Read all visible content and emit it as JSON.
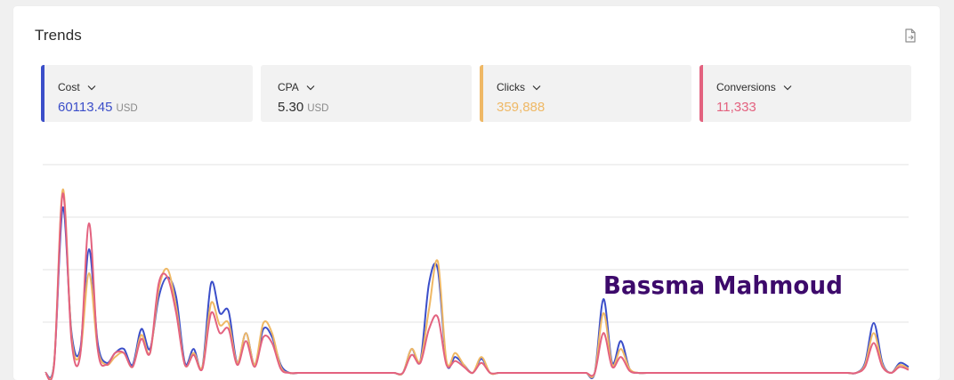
{
  "panel": {
    "title": "Trends",
    "export_icon": "file-export-icon"
  },
  "metrics": [
    {
      "label": "Cost",
      "value": "60113.45",
      "unit": "USD",
      "color": "#3b4ec9",
      "value_color": "#3b4ec9"
    },
    {
      "label": "CPA",
      "value": "5.30",
      "unit": "USD",
      "color": null,
      "value_color": "#2d2d2d"
    },
    {
      "label": "Clicks",
      "value": "359,888",
      "unit": "",
      "color": "#efb865",
      "value_color": "#efb865"
    },
    {
      "label": "Conversions",
      "value": "11,333",
      "unit": "",
      "color": "#e3627f",
      "value_color": "#e3627f"
    }
  ],
  "watermark": "Bassma Mahmoud",
  "chart_data": {
    "type": "line",
    "grid": true,
    "legend": "none",
    "ylim": [
      0,
      1
    ],
    "x": [
      0,
      1,
      2,
      3,
      4,
      5,
      6,
      7,
      8,
      9,
      10,
      11,
      12,
      13,
      14,
      15,
      16,
      17,
      18,
      19,
      20,
      21,
      22,
      23,
      24,
      25,
      26,
      27,
      28,
      29,
      30,
      31,
      32,
      33,
      34,
      35,
      36,
      37,
      38,
      39,
      40,
      41,
      42,
      43,
      44,
      45,
      46,
      47,
      48,
      49,
      50,
      51,
      52,
      53,
      54,
      55,
      56,
      57,
      58,
      59,
      60,
      61,
      62,
      63,
      64,
      65,
      66,
      67,
      68,
      69,
      70,
      71,
      72,
      73,
      74,
      75,
      76,
      77,
      78,
      79,
      80,
      81,
      82,
      83,
      84,
      85,
      86,
      87,
      88,
      89,
      90,
      91,
      92,
      93,
      94,
      95,
      96,
      97,
      98,
      99
    ],
    "series": [
      {
        "color": "#3b4ec9",
        "values": [
          0.0,
          0.05,
          0.83,
          0.2,
          0.12,
          0.62,
          0.15,
          0.05,
          0.1,
          0.12,
          0.04,
          0.22,
          0.12,
          0.38,
          0.48,
          0.38,
          0.05,
          0.12,
          0.03,
          0.45,
          0.3,
          0.31,
          0.05,
          0.2,
          0.04,
          0.22,
          0.18,
          0.04,
          0.0,
          0.0,
          0.0,
          0.0,
          0.0,
          0.0,
          0.0,
          0.0,
          0.0,
          0.0,
          0.0,
          0.0,
          0.0,
          0.0,
          0.12,
          0.06,
          0.45,
          0.52,
          0.05,
          0.08,
          0.04,
          0.0,
          0.07,
          0.0,
          0.0,
          0.0,
          0.0,
          0.0,
          0.0,
          0.0,
          0.0,
          0.0,
          0.0,
          0.0,
          0.0,
          0.0,
          0.37,
          0.05,
          0.16,
          0.02,
          0.0,
          0.0,
          0.0,
          0.0,
          0.0,
          0.0,
          0.0,
          0.0,
          0.0,
          0.0,
          0.0,
          0.0,
          0.0,
          0.0,
          0.0,
          0.0,
          0.0,
          0.0,
          0.0,
          0.0,
          0.0,
          0.0,
          0.0,
          0.0,
          0.0,
          0.0,
          0.05,
          0.25,
          0.05,
          0.0,
          0.05,
          0.03
        ]
      },
      {
        "color": "#efb865",
        "values": [
          0.0,
          0.05,
          0.92,
          0.18,
          0.1,
          0.5,
          0.12,
          0.04,
          0.08,
          0.1,
          0.03,
          0.19,
          0.1,
          0.42,
          0.52,
          0.33,
          0.04,
          0.1,
          0.03,
          0.35,
          0.24,
          0.25,
          0.05,
          0.2,
          0.04,
          0.25,
          0.2,
          0.03,
          0.0,
          0.0,
          0.0,
          0.0,
          0.0,
          0.0,
          0.0,
          0.0,
          0.0,
          0.0,
          0.0,
          0.0,
          0.0,
          0.0,
          0.12,
          0.06,
          0.32,
          0.56,
          0.06,
          0.1,
          0.04,
          0.0,
          0.08,
          0.0,
          0.0,
          0.0,
          0.0,
          0.0,
          0.0,
          0.0,
          0.0,
          0.0,
          0.0,
          0.0,
          0.0,
          0.0,
          0.3,
          0.04,
          0.12,
          0.02,
          0.0,
          0.0,
          0.0,
          0.0,
          0.0,
          0.0,
          0.0,
          0.0,
          0.0,
          0.0,
          0.0,
          0.0,
          0.0,
          0.0,
          0.0,
          0.0,
          0.0,
          0.0,
          0.0,
          0.0,
          0.0,
          0.0,
          0.0,
          0.0,
          0.0,
          0.0,
          0.04,
          0.2,
          0.04,
          0.0,
          0.04,
          0.02
        ]
      },
      {
        "color": "#e3627f",
        "values": [
          0.0,
          0.04,
          0.9,
          0.16,
          0.09,
          0.75,
          0.12,
          0.04,
          0.1,
          0.1,
          0.03,
          0.17,
          0.1,
          0.45,
          0.48,
          0.3,
          0.04,
          0.09,
          0.02,
          0.3,
          0.2,
          0.22,
          0.04,
          0.16,
          0.03,
          0.18,
          0.15,
          0.02,
          0.0,
          0.0,
          0.0,
          0.0,
          0.0,
          0.0,
          0.0,
          0.0,
          0.0,
          0.0,
          0.0,
          0.0,
          0.0,
          0.0,
          0.09,
          0.05,
          0.22,
          0.28,
          0.04,
          0.06,
          0.03,
          0.0,
          0.05,
          0.0,
          0.0,
          0.0,
          0.0,
          0.0,
          0.0,
          0.0,
          0.0,
          0.0,
          0.0,
          0.0,
          0.0,
          0.0,
          0.2,
          0.03,
          0.08,
          0.01,
          0.0,
          0.0,
          0.0,
          0.0,
          0.0,
          0.0,
          0.0,
          0.0,
          0.0,
          0.0,
          0.0,
          0.0,
          0.0,
          0.0,
          0.0,
          0.0,
          0.0,
          0.0,
          0.0,
          0.0,
          0.0,
          0.0,
          0.0,
          0.0,
          0.0,
          0.0,
          0.03,
          0.15,
          0.03,
          0.0,
          0.03,
          0.015
        ]
      }
    ]
  }
}
